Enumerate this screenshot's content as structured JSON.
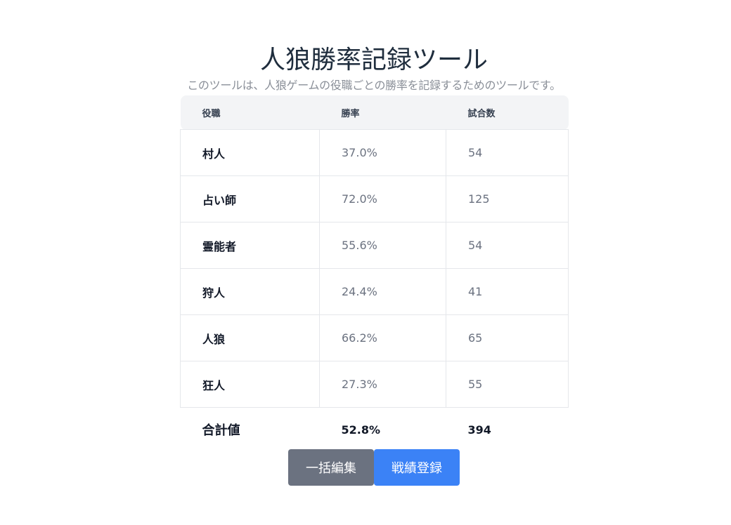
{
  "header": {
    "title": "人狼勝率記録ツール",
    "subtitle": "このツールは、人狼ゲームの役職ごとの勝率を記録するためのツールです。"
  },
  "table": {
    "columns": [
      "役職",
      "勝率",
      "試合数"
    ],
    "rows": [
      {
        "role": "村人",
        "win_rate": "37.0%",
        "games": "54"
      },
      {
        "role": "占い師",
        "win_rate": "72.0%",
        "games": "125"
      },
      {
        "role": "霊能者",
        "win_rate": "55.6%",
        "games": "54"
      },
      {
        "role": "狩人",
        "win_rate": "24.4%",
        "games": "41"
      },
      {
        "role": "人狼",
        "win_rate": "66.2%",
        "games": "65"
      },
      {
        "role": "狂人",
        "win_rate": "27.3%",
        "games": "55"
      }
    ],
    "total": {
      "label": "合計値",
      "win_rate": "52.8%",
      "games": "394"
    }
  },
  "actions": {
    "bulk_edit_label": "一括編集",
    "record_label": "戦績登録"
  },
  "colors": {
    "bulk_edit_button": "#6b7280",
    "record_button": "#3b82f6",
    "header_bg": "#f3f4f6"
  }
}
